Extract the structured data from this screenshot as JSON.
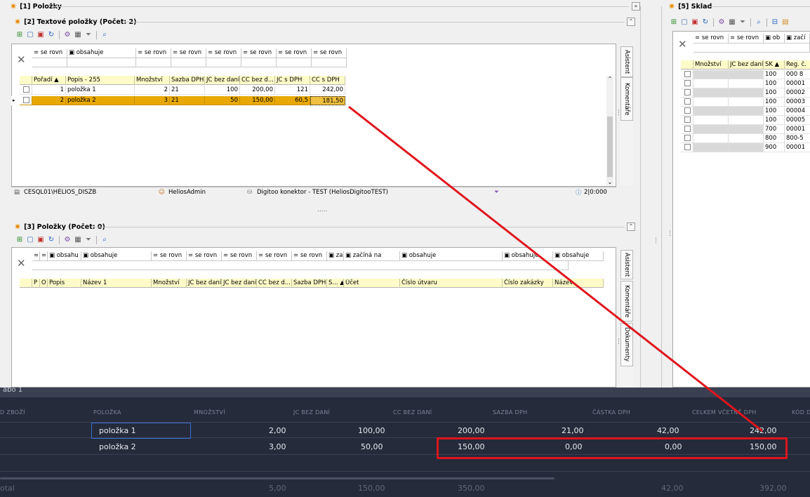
{
  "panels": {
    "polozky": {
      "title": "[1] Položky"
    },
    "textove": {
      "title": "[2] Textové položky (Počet: 2)"
    },
    "polozky3": {
      "title": "[3] Položky (Počet: 0)"
    },
    "sklad": {
      "title": "[5] Sklad"
    }
  },
  "textove_grid": {
    "filters": [
      "se rovn",
      "obsahuje",
      "se rovn",
      "se rovn",
      "se rovn",
      "se rovn",
      "se rovn",
      "se rovn"
    ],
    "columns": [
      "Pořadí",
      "Popis - 255",
      "Množství",
      "Sazba DPH",
      "JC bez daní",
      "CC bez d...",
      "JC s DPH",
      "CC s DPH"
    ],
    "rows": [
      {
        "poradi": "1",
        "popis": "položka 1",
        "mnozstvi": "2",
        "sazba": "21",
        "jc_bez": "100",
        "cc_bez": "200,00",
        "jc_s": "121",
        "cc_s": "242,00"
      },
      {
        "poradi": "2",
        "popis": "položka 2",
        "mnozstvi": "3",
        "sazba": "21",
        "jc_bez": "50",
        "cc_bez": "150,00",
        "jc_s": "60,5",
        "cc_s": "181,50"
      }
    ],
    "side_tabs": [
      "Asistent",
      "Komentáře"
    ]
  },
  "statusbar": {
    "server": "CESQL01\\HELIOS_DISZB",
    "user": "HeliosAdmin",
    "db": "Digitoo konektor - TEST (HeliosDigitooTEST)",
    "info": "2|0:000"
  },
  "splitter_dots": ".....",
  "polozky3_grid": {
    "filters": [
      "obsahu",
      "obsahuje",
      "se rovn",
      "se rovn",
      "se rovn",
      "se rovn",
      "se rovn",
      "za",
      "začíná na",
      "obsahuje",
      "obsahuje",
      "obsahuje"
    ],
    "columns": [
      "P",
      "O",
      "Popis",
      "Název 1",
      "Množství",
      "JC bez daní",
      "JC bez daní",
      "CC bez d...",
      "Sazba DPH",
      "S...",
      "Účet",
      "Číslo útvaru",
      "Číslo zakázky",
      "Název"
    ],
    "side_tabs": [
      "Asistent",
      "Komentáře",
      "Dokumenty"
    ]
  },
  "sklad_grid": {
    "filters": [
      "se rovn",
      "se rovn",
      "ob",
      "začí"
    ],
    "columns": [
      "Množství",
      "JC bez daní",
      "SK",
      "Reg. č."
    ],
    "rows": [
      {
        "sk": "100",
        "reg": "000 8"
      },
      {
        "sk": "100",
        "reg": "00001"
      },
      {
        "sk": "100",
        "reg": "00002"
      },
      {
        "sk": "100",
        "reg": "00003"
      },
      {
        "sk": "100",
        "reg": "00004"
      },
      {
        "sk": "100",
        "reg": "00005"
      },
      {
        "sk": "700",
        "reg": "00001"
      },
      {
        "sk": "800",
        "reg": "800-5"
      },
      {
        "sk": "900",
        "reg": "00001"
      }
    ]
  },
  "web_table": {
    "top_label": "abo 1",
    "headers": [
      "D ZBOŽÍ",
      "POLOŽKA",
      "MNOŽSTVÍ",
      "JC BEZ DANÍ",
      "CC BEZ DANÍ",
      "SAZBA DPH",
      "ČÁSTKA DPH",
      "CELKEM VČETNĚ DPH",
      "KÓD D"
    ],
    "rows": [
      {
        "polozka": "položka 1",
        "mnozstvi": "2,00",
        "jc": "100,00",
        "cc": "200,00",
        "sazba": "21,00",
        "castka": "42,00",
        "celkem": "242,00"
      },
      {
        "polozka": "položka 2",
        "mnozstvi": "3,00",
        "jc": "50,00",
        "cc": "150,00",
        "sazba": "0,00",
        "castka": "0,00",
        "celkem": "150,00"
      }
    ],
    "total": {
      "label": "otal",
      "mnozstvi": "5,00",
      "jc": "150,00",
      "cc": "350,00",
      "castka": "42,00",
      "celkem": "392,00"
    }
  },
  "colors": {
    "highlight": "#e8a800",
    "annotation": "#e0141c",
    "dark_bg": "#252b3b"
  }
}
